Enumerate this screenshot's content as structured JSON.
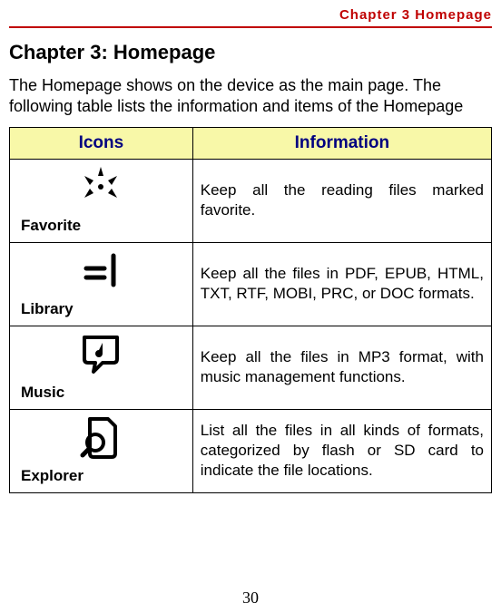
{
  "running_header": "Chapter 3 Homepage",
  "chapter_title": "Chapter 3: Homepage",
  "intro": "The Homepage shows on the device as the main page. The following table lists the information and items of the Homepage",
  "table": {
    "headers": {
      "icons": "Icons",
      "info": "Information"
    },
    "rows": [
      {
        "icon_name": "favorite-icon",
        "caption": "Favorite",
        "info": "Keep all the reading files marked favorite."
      },
      {
        "icon_name": "library-icon",
        "caption": "Library",
        "info": "Keep all the files in PDF, EPUB, HTML, TXT, RTF, MOBI, PRC, or DOC formats."
      },
      {
        "icon_name": "music-icon",
        "caption": "Music",
        "info": "Keep all the files in MP3 format, with music management functions."
      },
      {
        "icon_name": "explorer-icon",
        "caption": "Explorer",
        "info": "List all the files in all kinds of formats, categorized by flash or SD card to indicate the file locations."
      }
    ]
  },
  "page_number": "30"
}
